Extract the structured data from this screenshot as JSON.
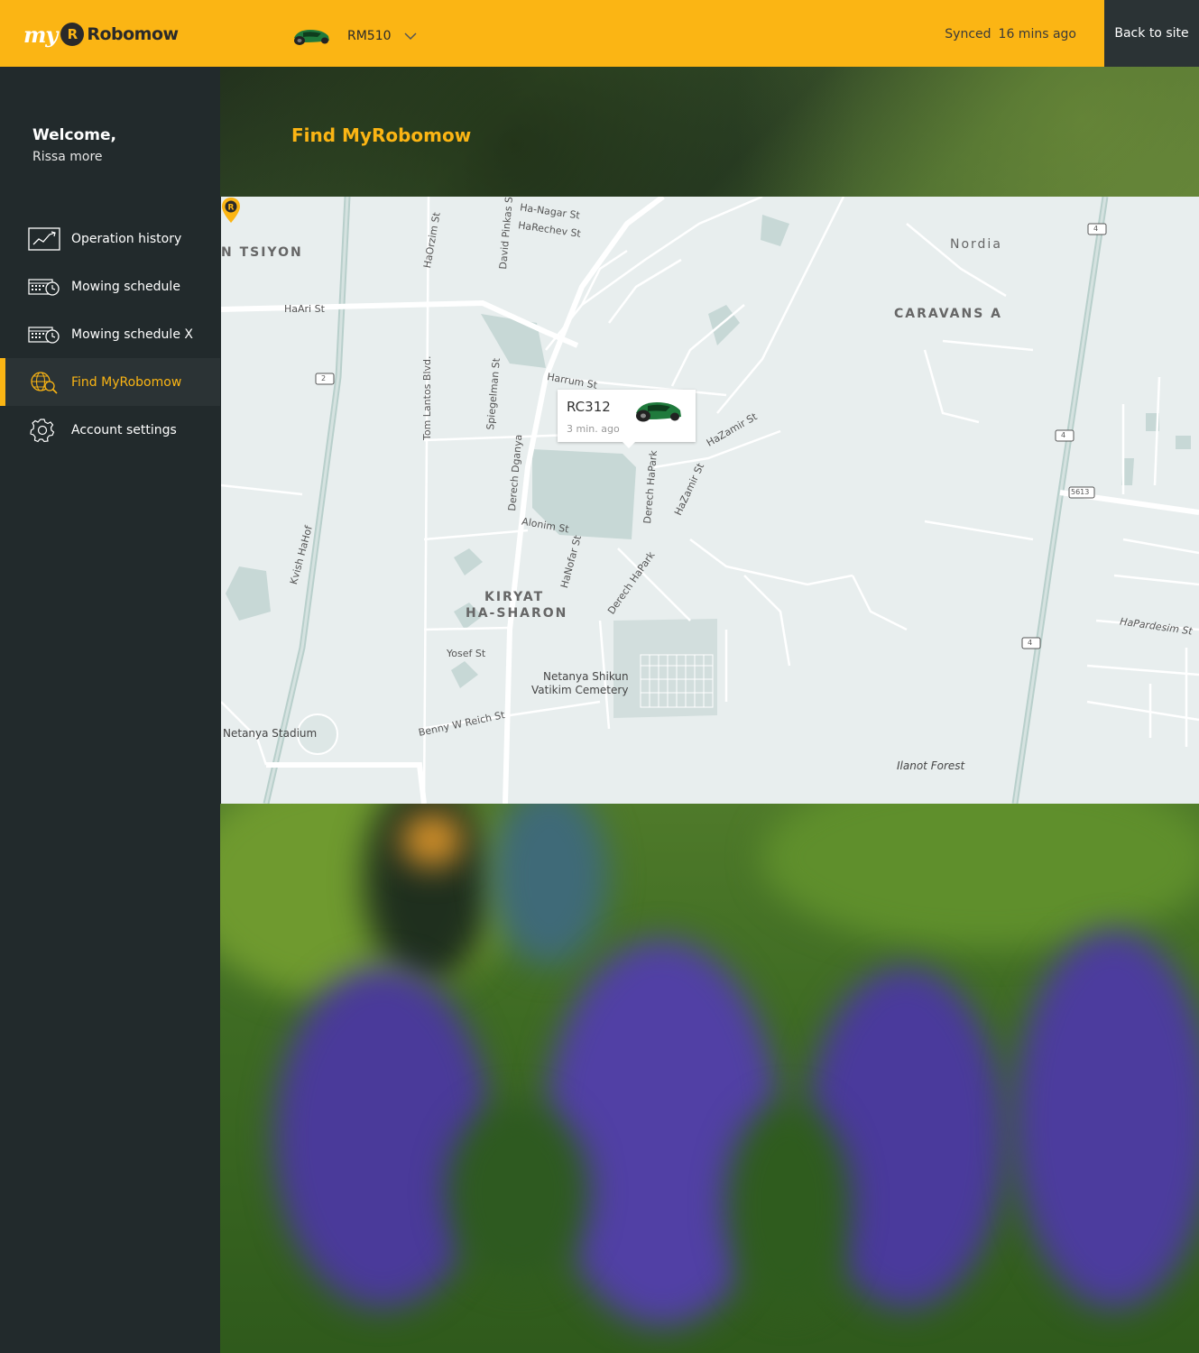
{
  "header": {
    "logo_my": "my",
    "logo_r": "R",
    "logo_text": "Robomow",
    "device_name": "RM510",
    "sync_label": "Synced",
    "sync_time": "16 mins ago",
    "back_label": "Back to site"
  },
  "sidebar": {
    "welcome_title": "Welcome,",
    "user_name": "Rissa more",
    "items": [
      {
        "label": "Operation history",
        "icon": "chart-icon"
      },
      {
        "label": "Mowing schedule",
        "icon": "calendar-clock-icon"
      },
      {
        "label": "Mowing schedule X",
        "icon": "calendar-clock-icon"
      },
      {
        "label": "Find MyRobomow",
        "icon": "globe-search-icon",
        "active": true
      },
      {
        "label": "Account settings",
        "icon": "gear-icon"
      }
    ]
  },
  "main": {
    "page_title": "Find MyRobomow",
    "popup": {
      "name": "RC312",
      "time": "3 min. ago"
    },
    "map_labels": {
      "tsiyon": "N TSIYON",
      "caravans": "CARAVANS A",
      "nordia": "Nordia",
      "kiryat": "KIRYAT",
      "hasharon": "HA-SHARON",
      "stadium": "Netanya Stadium",
      "cemetery1": "Netanya Shikun",
      "cemetery2": "Vatikim Cemetery",
      "forest": "Ilanot Forest",
      "haari": "HaAri St",
      "haorzim": "HaOrzim St",
      "david": "David Pinkas St",
      "hanagar": "Ha-Nagar St",
      "harechev": "HaRechev St",
      "harrum": "Harrum St",
      "tomlantos": "Tom Lantos Blvd.",
      "spiegelman": "Spiegelman St",
      "dganya": "Derech Dganya",
      "alonim": "Alonim St",
      "hanofar": "HaNofar St",
      "hapark": "Derech HaPark",
      "hapark2": "Derech HaPark",
      "hazamir": "HaZamir St",
      "hazamir2": "HaZamir St",
      "yosef": "Yosef St",
      "benny": "Benny W Reich St",
      "kvish": "Kvish HaHof",
      "hapardesim": "HaPardesim St",
      "road2": "2",
      "road4a": "4",
      "road4b": "4",
      "road4c": "4",
      "road5613": "5613"
    }
  },
  "colors": {
    "accent": "#fbb514",
    "sidebar": "#222a2c",
    "active_bg": "#2b3335",
    "map_bg": "#e8eeee"
  }
}
